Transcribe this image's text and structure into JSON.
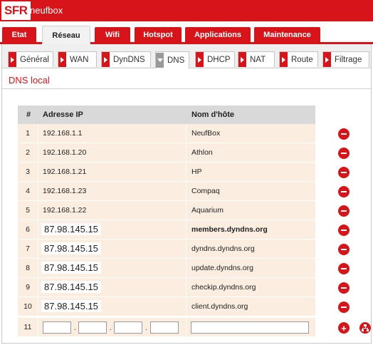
{
  "header": {
    "logo": "SFR",
    "brand": "neufbox",
    "accent": "#d8141b"
  },
  "main_tabs": [
    {
      "label": "Etat",
      "active": false
    },
    {
      "label": "Réseau",
      "active": true
    },
    {
      "label": "Wifi",
      "active": false
    },
    {
      "label": "Hotspot",
      "active": false
    },
    {
      "label": "Applications",
      "active": false
    },
    {
      "label": "Maintenance",
      "active": false
    }
  ],
  "sub_tabs": [
    {
      "label": "Général",
      "active": false
    },
    {
      "label": "WAN",
      "active": false
    },
    {
      "label": "DynDNS",
      "active": false
    },
    {
      "label": "DNS",
      "active": true
    },
    {
      "label": "DHCP",
      "active": false
    },
    {
      "label": "NAT",
      "active": false
    },
    {
      "label": "Route",
      "active": false
    },
    {
      "label": "Filtrage",
      "active": false
    }
  ],
  "section": {
    "title": "DNS local"
  },
  "table": {
    "headers": {
      "num": "#",
      "ip": "Adresse IP",
      "host": "Nom d'hôte"
    },
    "rows": [
      {
        "num": "1",
        "ip": "192.168.1.1",
        "host": "NeufBox"
      },
      {
        "num": "2",
        "ip": "192.168.1.20",
        "host": "Athlon"
      },
      {
        "num": "3",
        "ip": "192.168.1.21",
        "host": "HP"
      },
      {
        "num": "4",
        "ip": "192.168.1.23",
        "host": "Compaq"
      },
      {
        "num": "5",
        "ip": "192.168.1.22",
        "host": "Aquarium"
      },
      {
        "num": "6",
        "ip": "87.98.145.15",
        "host": "members.dyndns.org"
      },
      {
        "num": "7",
        "ip": "87.98.145.15",
        "host": "dyndns.dyndns.org"
      },
      {
        "num": "8",
        "ip": "87.98.145.15",
        "host": "update.dyndns.org"
      },
      {
        "num": "9",
        "ip": "87.98.145.15",
        "host": "checkip.dyndns.org"
      },
      {
        "num": "10",
        "ip": "87.98.145.15",
        "host": "client.dyndns.org"
      }
    ],
    "new_row": {
      "num": "11",
      "ip_octets": [
        "",
        "",
        "",
        ""
      ],
      "host": ""
    }
  },
  "icons": {
    "delete": "minus-circle-icon",
    "add": "plus-circle-icon",
    "network": "network-icon"
  }
}
